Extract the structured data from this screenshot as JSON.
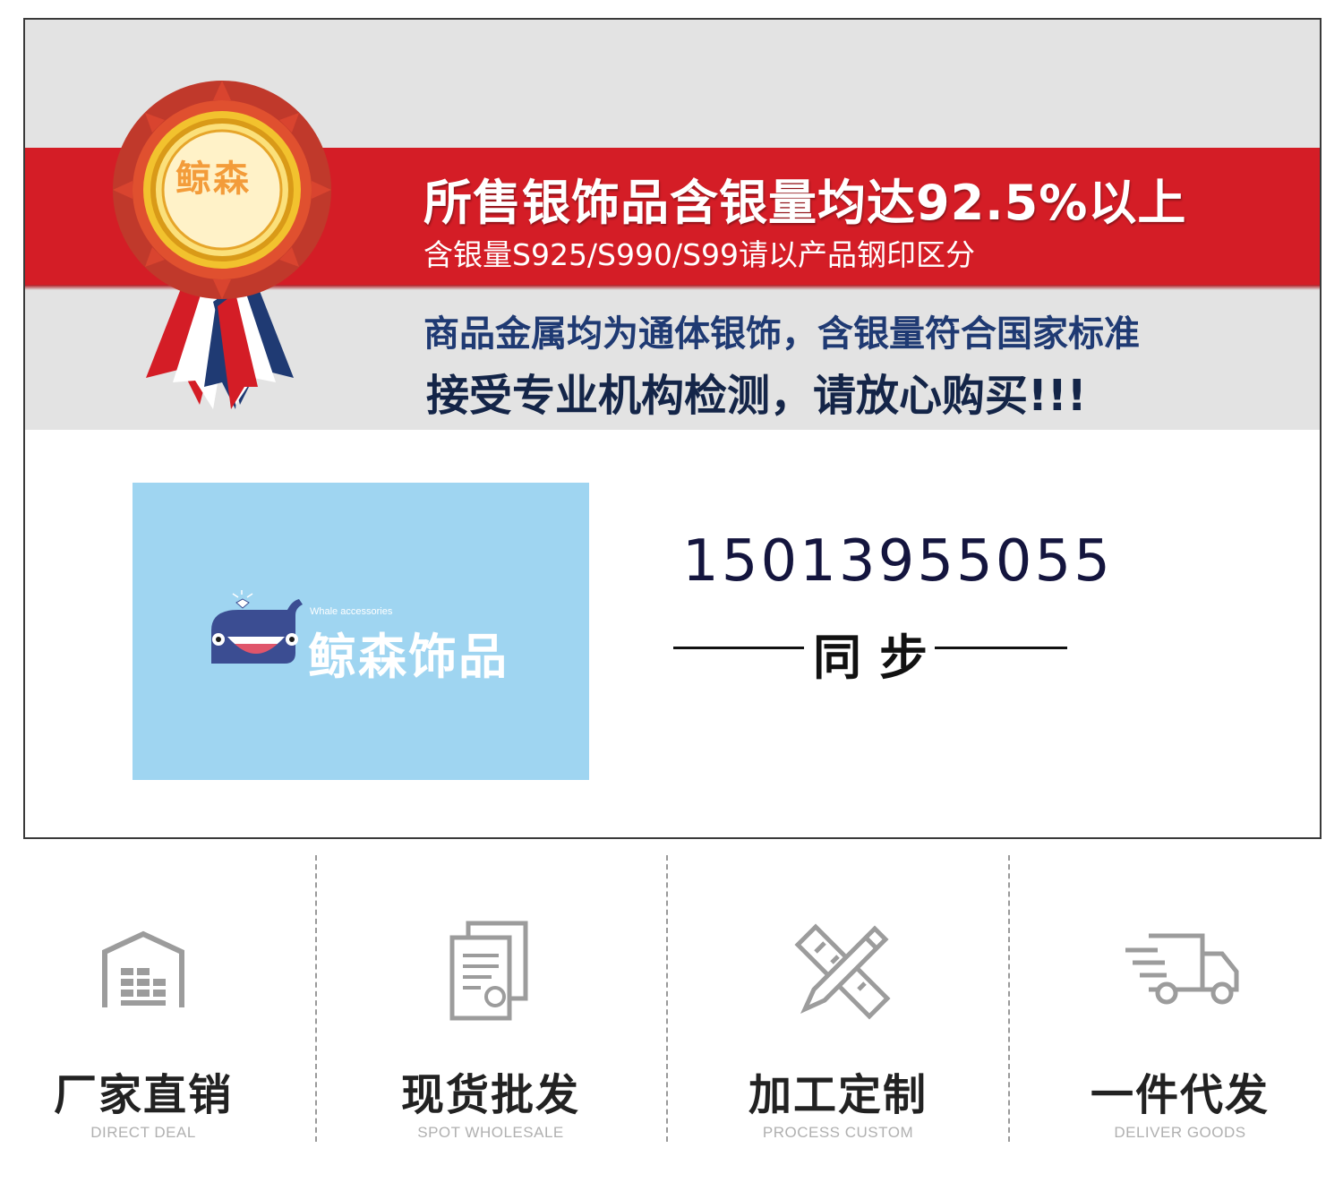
{
  "banner": {
    "medal_text": "鲸森",
    "headline": "所售银饰品含银量均达92.5%以上",
    "subline": "含银量S925/S990/S99请以产品钢印区分",
    "line1": "商品金属均为通体银饰，含银量符合国家标准",
    "line2": "接受专业机构检测，请放心购买!!!"
  },
  "logo": {
    "tagline": "Whale accessories",
    "name": "鲸森饰品"
  },
  "contact": {
    "phone": "15013955055",
    "sync": "同步"
  },
  "features": [
    {
      "title": "厂家直销",
      "subtitle": "DIRECT DEAL",
      "icon": "warehouse-icon"
    },
    {
      "title": "现货批发",
      "subtitle": "SPOT WHOLESALE",
      "icon": "document-icon"
    },
    {
      "title": "加工定制",
      "subtitle": "PROCESS CUSTOM",
      "icon": "pencil-ruler-icon"
    },
    {
      "title": "一件代发",
      "subtitle": "DELIVER GOODS",
      "icon": "delivery-truck-icon"
    }
  ],
  "colors": {
    "red": "#d41d26",
    "navy": "#1f3a73",
    "logo_bg": "#9fd5f1"
  }
}
